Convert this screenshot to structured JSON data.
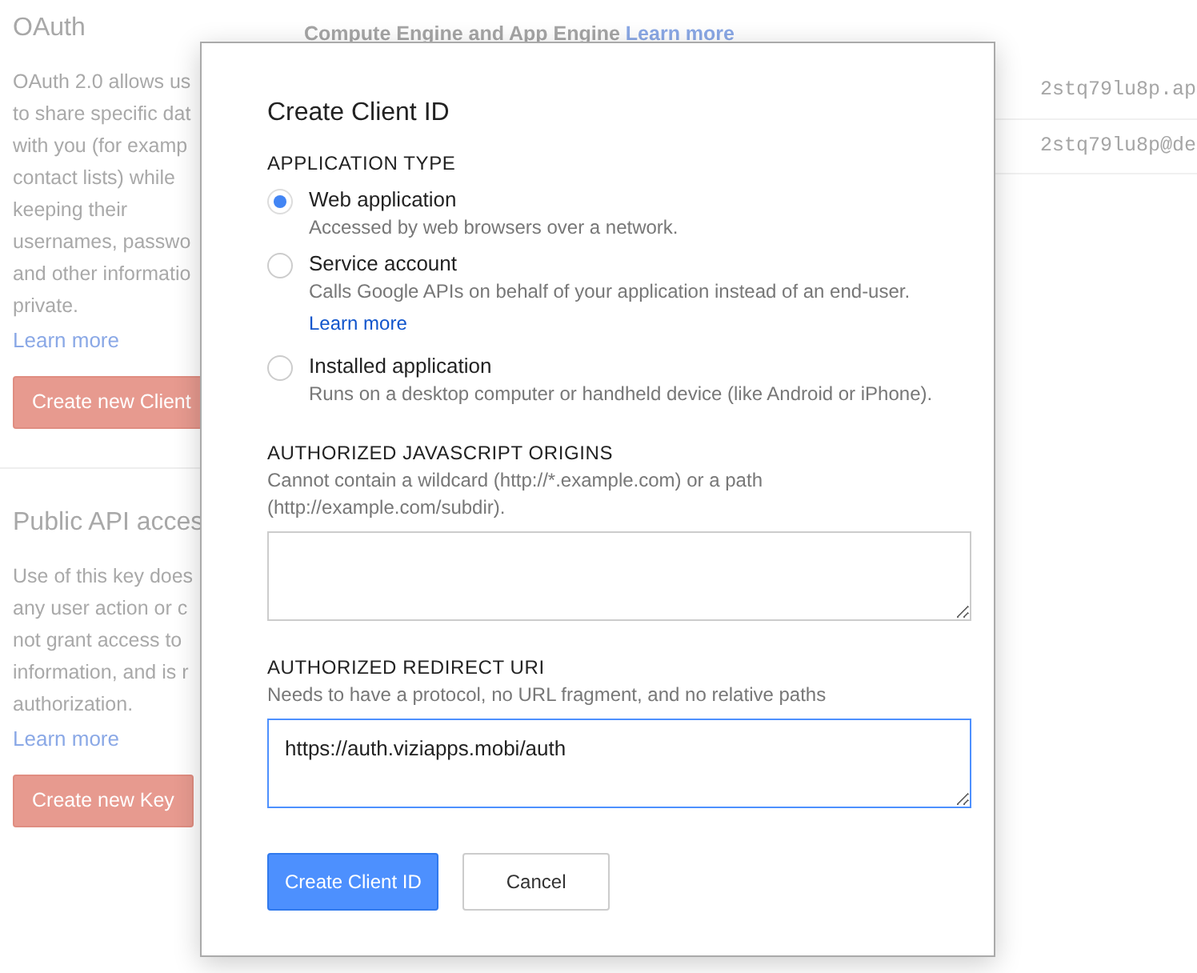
{
  "background": {
    "sections": [
      {
        "title": "OAuth",
        "lines": [
          "OAuth 2.0 allows us",
          "to share specific dat",
          "with you (for examp",
          "contact lists) while",
          "keeping their",
          "usernames, passwo",
          "and other informatio",
          "private."
        ],
        "link": "Learn more",
        "button": "Create new Client"
      },
      {
        "title": "Public API acces",
        "lines": [
          "Use of this key does",
          "any user action or c",
          "not grant access to",
          "information, and is r",
          "authorization."
        ],
        "link": "Learn more",
        "button": "Create new Key"
      }
    ],
    "note": {
      "text": "Compute Engine and App Engine",
      "link": "Learn more"
    },
    "rows": [
      "2stq79lu8p.ap",
      "2stq79lu8p@de"
    ]
  },
  "dialog": {
    "title": "Create Client ID",
    "application_type": {
      "label": "APPLICATION TYPE",
      "options": [
        {
          "label": "Web application",
          "description": "Accessed by web browsers over a network.",
          "selected": true
        },
        {
          "label": "Service account",
          "description": "Calls Google APIs on behalf of your application instead of an end-user.",
          "link": "Learn more",
          "selected": false
        },
        {
          "label": "Installed application",
          "description": "Runs on a desktop computer or handheld device (like Android or iPhone).",
          "selected": false
        }
      ]
    },
    "fields": [
      {
        "label": "AUTHORIZED JAVASCRIPT ORIGINS",
        "help": "Cannot contain a wildcard (http://*.example.com) or a path (http://example.com/subdir).",
        "focused": false
      },
      {
        "label": "AUTHORIZED REDIRECT URI",
        "help": "Needs to have a protocol, no URL fragment, and no relative paths",
        "value": "https://auth.viziapps.mobi/auth",
        "focused": true
      }
    ],
    "buttons": [
      {
        "label": "Create Client ID",
        "kind": "primary"
      },
      {
        "label": "Cancel",
        "kind": "secondary"
      }
    ]
  }
}
